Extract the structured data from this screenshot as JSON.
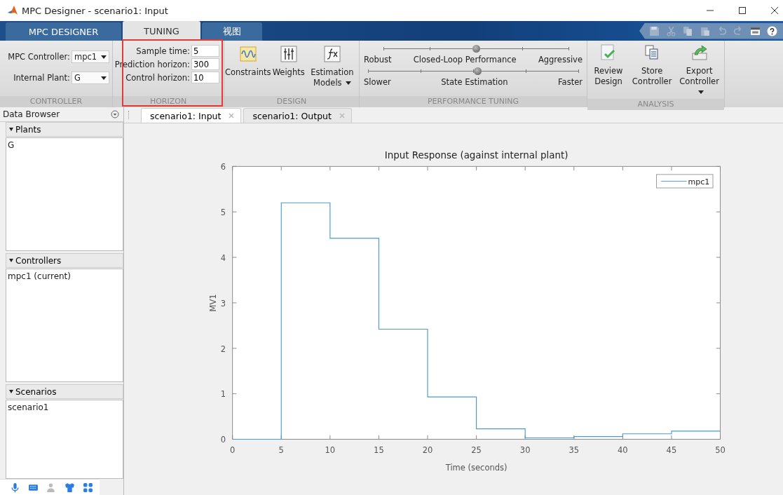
{
  "window": {
    "title": "MPC Designer - scenario1: Input"
  },
  "ribbon_tabs": [
    {
      "label": "MPC DESIGNER",
      "selected": false
    },
    {
      "label": "TUNING",
      "selected": true
    },
    {
      "label": "视图",
      "selected": false
    }
  ],
  "controller_group": {
    "label": "CONTROLLER",
    "fields": [
      {
        "label": "MPC Controller:",
        "value": "mpc1"
      },
      {
        "label": "Internal Plant:",
        "value": "G"
      }
    ]
  },
  "horizon_group": {
    "label": "HORIZON",
    "fields": [
      {
        "label": "Sample time:",
        "value": "5"
      },
      {
        "label": "Prediction horizon:",
        "value": "300"
      },
      {
        "label": "Control horizon:",
        "value": "10"
      }
    ]
  },
  "design_group": {
    "label": "DESIGN",
    "buttons": [
      {
        "label": "Constraints",
        "kind": "constraints",
        "dropdown": false
      },
      {
        "label": "Weights",
        "kind": "weights",
        "dropdown": false
      },
      {
        "label": "Estimation Models",
        "kind": "estimation",
        "dropdown": true
      }
    ]
  },
  "performance_group": {
    "label": "PERFORMANCE TUNING",
    "sliders": [
      {
        "title": "Closed-Loop Performance",
        "left": "Robust",
        "right": "Aggressive",
        "level": 0.5
      },
      {
        "title": "State Estimation",
        "left": "Slower",
        "right": "Faster",
        "level": 0.52
      }
    ]
  },
  "analysis_group": {
    "label": "ANALYSIS",
    "buttons": [
      {
        "label": "Review Design",
        "kind": "review",
        "dropdown": false
      },
      {
        "label": "Store Controller",
        "kind": "store",
        "dropdown": false
      },
      {
        "label": "Export Controller",
        "kind": "export",
        "dropdown": true
      }
    ]
  },
  "data_browser": {
    "title": "Data Browser",
    "sections": [
      {
        "title": "Plants",
        "expanded": true,
        "items": [
          "G"
        ]
      },
      {
        "title": "Controllers",
        "expanded": true,
        "items": [
          "mpc1 (current)"
        ]
      },
      {
        "title": "Scenarios",
        "expanded": true,
        "items": [
          "scenario1"
        ]
      }
    ]
  },
  "document_tabs": [
    {
      "label": "scenario1: Input",
      "selected": true
    },
    {
      "label": "scenario1: Output",
      "selected": false
    }
  ],
  "plot": {
    "chart_data": {
      "type": "line",
      "title": "Input Response (against internal plant)",
      "xlabel": "Time (seconds)",
      "ylabel": "MV1",
      "x": [
        0,
        5,
        5,
        10,
        10,
        15,
        15,
        20,
        20,
        25,
        25,
        30,
        30,
        35,
        35,
        40,
        40,
        45,
        45,
        50
      ],
      "series": [
        {
          "name": "mpc1",
          "color": "#4a9ccc",
          "values": [
            0,
            0,
            5.2,
            5.2,
            4.42,
            4.42,
            2.42,
            2.42,
            0.93,
            0.93,
            0.23,
            0.23,
            0.03,
            0.03,
            0.06,
            0.06,
            0.12,
            0.12,
            0.18,
            0.18
          ]
        }
      ],
      "xlim": [
        0,
        50
      ],
      "ylim": [
        0,
        6
      ],
      "xticks": [
        0,
        5,
        10,
        15,
        20,
        25,
        30,
        35,
        40,
        45,
        50
      ],
      "yticks": [
        0,
        1,
        2,
        3,
        4,
        5,
        6
      ]
    }
  }
}
